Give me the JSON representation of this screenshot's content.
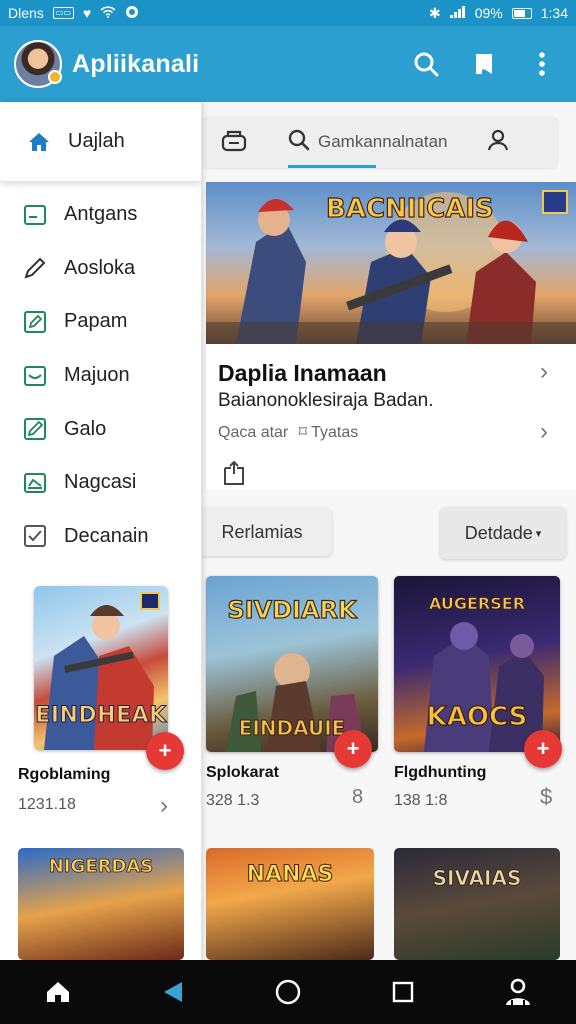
{
  "status_bar": {
    "carrier": "Dlens",
    "battery_text": "09%",
    "time": "1:34"
  },
  "app_bar": {
    "title": "Apliikanali",
    "colors": {
      "primary": "#2b9fd0",
      "status": "#1b93c6"
    },
    "icons": [
      "search-icon",
      "bookmark-icon",
      "more-vert-icon"
    ]
  },
  "drawer": {
    "active_item": {
      "label": "Uajlah",
      "icon": "home-icon"
    },
    "items": [
      {
        "label": "Antgans",
        "icon": "square-icon"
      },
      {
        "label": "Aosloka",
        "icon": "pencil-icon"
      },
      {
        "label": "Papam",
        "icon": "edit-icon"
      },
      {
        "label": "Majuon",
        "icon": "tray-icon"
      },
      {
        "label": "Galo",
        "icon": "pen-square-icon"
      },
      {
        "label": "Nagcasi",
        "icon": "inbox-icon"
      },
      {
        "label": "Decanain",
        "icon": "check-icon"
      }
    ],
    "card": {
      "art_title": "EINDHEAK",
      "title": "Rgoblaming",
      "meta": "1231.18"
    }
  },
  "search": {
    "placeholder": "Gamkannalnatan"
  },
  "featured": {
    "logo": "BACNIICAIS",
    "title": "Daplia Inamaan",
    "subtitle": "Baianonoklesiraja Badan.",
    "meta": "Qaca atar",
    "meta_tag": "Tyatas"
  },
  "chips": {
    "left": "Rerlamias",
    "right": "Detdade"
  },
  "games": [
    {
      "art_title": "SIVDIARK",
      "art_sub": "EINDAUIE",
      "title": "Splokarat",
      "meta": "328 1.3"
    },
    {
      "art_title": "AUGERSER",
      "art_sub": "KAOCS",
      "title": "Flgdhunting",
      "meta": "138 1:8"
    }
  ],
  "bottom_row": [
    {
      "art_title": "NIGERDAS"
    },
    {
      "art_title": "NANAS"
    },
    {
      "art_title": "SIVAIAS"
    }
  ],
  "nav": [
    "home-icon",
    "back-icon",
    "home-circle-icon",
    "recents-icon",
    "profile-icon"
  ]
}
